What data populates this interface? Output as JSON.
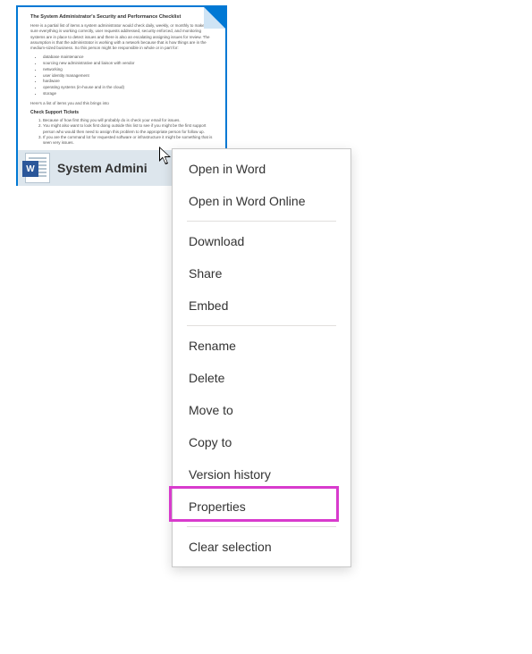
{
  "file": {
    "name": "System Admini",
    "preview": {
      "title": "The System Administrator's Security and Performance Checklist",
      "intro": "Here is a partial list of items a system administrator would check daily, weekly, or monthly to make sure everything is working correctly, user requests addressed, security enforced, and monitoring systems are in place to detect issues and there is also an escalating assigning issues for review. The assumption is that the administrator is working with a network because that is how things are in the medium-sized business. So this person might be responsible in whole or in part for:",
      "bullets": [
        "database maintenance",
        "sourcing new administrative and liaison with vendor",
        "networking",
        "user identity management",
        "hardware",
        "operating systems (in-house and in the cloud)",
        "storage"
      ],
      "midline": "Here's a list of items you and this brings into",
      "subhead": "Check Support Tickets",
      "numitems": [
        "Because of how first thing you will probably do is check your email for issues.",
        "You might also want to look first doing outside this list to see if you might be the first support person who would then need to assign this problem to the appropriate person for follow up.",
        "If you are the command lot for requested software or infrastructure it might be something that is seen very issues."
      ]
    }
  },
  "menu": {
    "items": [
      "Open in Word",
      "Open in Word Online",
      "Download",
      "Share",
      "Embed",
      "Rename",
      "Delete",
      "Move to",
      "Copy to",
      "Version history",
      "Properties",
      "Clear selection"
    ]
  },
  "highlight_target": "Version history"
}
